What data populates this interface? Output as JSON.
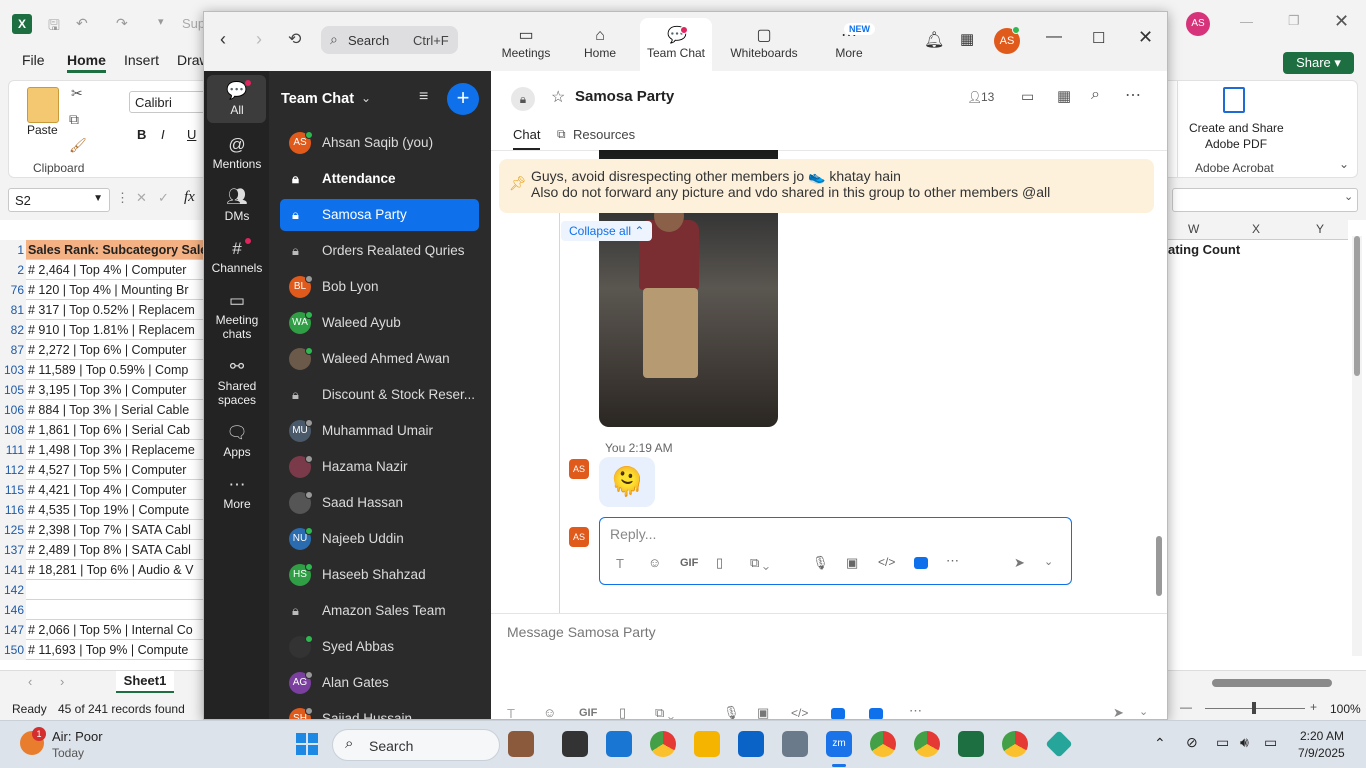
{
  "excel": {
    "title_fragment": "Sup",
    "tabs": [
      "File",
      "Home",
      "Insert",
      "Draw"
    ],
    "font_name": "Calibri",
    "clipboard": {
      "paste": "Paste",
      "group": "Clipboard"
    },
    "format_buttons": [
      "B",
      "I",
      "U"
    ],
    "acrobat": {
      "label_line1": "Create and Share",
      "label_line2": "Adobe PDF",
      "group": "Adobe Acrobat"
    },
    "share_button": "Share",
    "account_initials": "AS",
    "name_box": "S2",
    "fx": "fx",
    "columns_right": [
      "W",
      "X",
      "Y"
    ],
    "header_right": "ating Count",
    "rows": [
      {
        "n": "1",
        "text": "Sales Rank: Subcategory Sale"
      },
      {
        "n": "2",
        "text": "# 2,464 | Top 4% | Computer"
      },
      {
        "n": "76",
        "text": "# 120 | Top 4% | Mounting Br"
      },
      {
        "n": "81",
        "text": "# 317 | Top 0.52% | Replacem"
      },
      {
        "n": "82",
        "text": "# 910 | Top 1.81% | Replacem"
      },
      {
        "n": "87",
        "text": "# 2,272 | Top 6% | Computer"
      },
      {
        "n": "103",
        "text": "# 11,589 | Top 0.59% | Comp"
      },
      {
        "n": "105",
        "text": "# 3,195 | Top 3% | Computer"
      },
      {
        "n": "106",
        "text": "# 884 | Top 3% | Serial Cable"
      },
      {
        "n": "108",
        "text": "# 1,861 | Top 6% | Serial Cab"
      },
      {
        "n": "111",
        "text": "# 1,498 | Top 3% | Replaceme"
      },
      {
        "n": "112",
        "text": "# 4,527 | Top 5% | Computer"
      },
      {
        "n": "115",
        "text": "# 4,421 | Top 4% | Computer"
      },
      {
        "n": "116",
        "text": "# 4,535 | Top 19% | Compute"
      },
      {
        "n": "125",
        "text": "# 2,398 | Top 7% | SATA Cabl"
      },
      {
        "n": "137",
        "text": "# 2,489 | Top 8% | SATA Cabl"
      },
      {
        "n": "141",
        "text": "# 18,281 | Top 6% | Audio & V"
      },
      {
        "n": "142",
        "text": ""
      },
      {
        "n": "146",
        "text": ""
      },
      {
        "n": "147",
        "text": "# 2,066 | Top 5% | Internal Co"
      },
      {
        "n": "150",
        "text": "# 11,693 | Top 9% | Compute"
      }
    ],
    "sheet_tab": "Sheet1",
    "status": {
      "ready": "Ready",
      "records": "45 of 241 records found",
      "zoom": "100%"
    }
  },
  "zoom": {
    "search_placeholder": "Search",
    "search_shortcut": "Ctrl+F",
    "nav": [
      {
        "label": "Meetings",
        "icon": "meetings-icon"
      },
      {
        "label": "Home",
        "icon": "home-icon"
      },
      {
        "label": "Team Chat",
        "icon": "team-chat-icon"
      },
      {
        "label": "Whiteboards",
        "icon": "whiteboards-icon"
      },
      {
        "label": "More",
        "icon": "more-icon"
      }
    ],
    "new_badge": "NEW",
    "avatar_initials": "AS",
    "rail": [
      {
        "label": "All",
        "icon": "all-icon"
      },
      {
        "label": "Mentions",
        "icon": "mentions-icon"
      },
      {
        "label": "DMs",
        "icon": "dms-icon"
      },
      {
        "label": "Channels",
        "icon": "channels-icon"
      },
      {
        "label": "Meeting chats",
        "icon": "meeting-chats-icon"
      },
      {
        "label": "Shared spaces",
        "icon": "shared-spaces-icon"
      },
      {
        "label": "Apps",
        "icon": "apps-icon"
      },
      {
        "label": "More",
        "icon": "more-rail-icon"
      }
    ],
    "list_title": "Team Chat",
    "channels": [
      {
        "name": "Ahsan Saqib (you)",
        "type": "avatar",
        "initials": "AS",
        "color": "#e05a1c",
        "status": "online"
      },
      {
        "name": "Attendance",
        "type": "lock",
        "bold": true
      },
      {
        "name": "Samosa Party",
        "type": "lock",
        "active": true
      },
      {
        "name": "Orders Realated Quries",
        "type": "lock"
      },
      {
        "name": "Bob Lyon",
        "type": "avatar",
        "initials": "BL",
        "color": "#e05a1c",
        "status": "away"
      },
      {
        "name": "Waleed Ayub",
        "type": "avatar",
        "initials": "WA",
        "color": "#2f9e44",
        "status": "online"
      },
      {
        "name": "Waleed Ahmed Awan",
        "type": "avatar",
        "initials": "",
        "color": "#6b5a4a",
        "status": "online"
      },
      {
        "name": "Discount & Stock Reser...",
        "type": "lock"
      },
      {
        "name": "Muhammad Umair",
        "type": "avatar",
        "initials": "MU",
        "color": "#4a5a6a",
        "status": "away"
      },
      {
        "name": "Hazama Nazir",
        "type": "avatar",
        "initials": "",
        "color": "#7a3a4a",
        "status": "away"
      },
      {
        "name": "Saad Hassan",
        "type": "avatar",
        "initials": "",
        "color": "#555",
        "status": "away"
      },
      {
        "name": "Najeeb Uddin",
        "type": "avatar",
        "initials": "NU",
        "color": "#2b6cb0",
        "status": "online"
      },
      {
        "name": "Haseeb Shahzad",
        "type": "avatar",
        "initials": "HS",
        "color": "#2f9e44",
        "status": "online"
      },
      {
        "name": "Amazon Sales Team",
        "type": "lock"
      },
      {
        "name": "Syed Abbas",
        "type": "avatar",
        "initials": "",
        "color": "#333",
        "status": "online"
      },
      {
        "name": "Alan Gates",
        "type": "avatar",
        "initials": "AG",
        "color": "#7b3fa0",
        "status": "away"
      },
      {
        "name": "Sajjad Hussain",
        "type": "avatar",
        "initials": "SH",
        "color": "#e05a1c",
        "status": "away"
      }
    ],
    "chat": {
      "title": "Samosa Party",
      "member_count": "13",
      "tabs": [
        "Chat",
        "Resources"
      ],
      "pinned_line1": "Guys, avoid disrespecting other members jo 👟 khatay hain",
      "pinned_line2": "Also do not forward any picture and vdo shared in this group to other members @all",
      "collapse_all": "Collapse all",
      "message_meta": "You 2:19 AM",
      "message_emoji": "🫠",
      "my_initials": "AS",
      "reply_placeholder": "Reply...",
      "composer_placeholder": "Message Samosa Party",
      "gif": "GIF"
    }
  },
  "taskbar": {
    "weather_title": "Air: Poor",
    "weather_sub": "Today",
    "weather_badge": "1",
    "search": "Search",
    "time": "2:20 AM",
    "date": "7/9/2025"
  }
}
